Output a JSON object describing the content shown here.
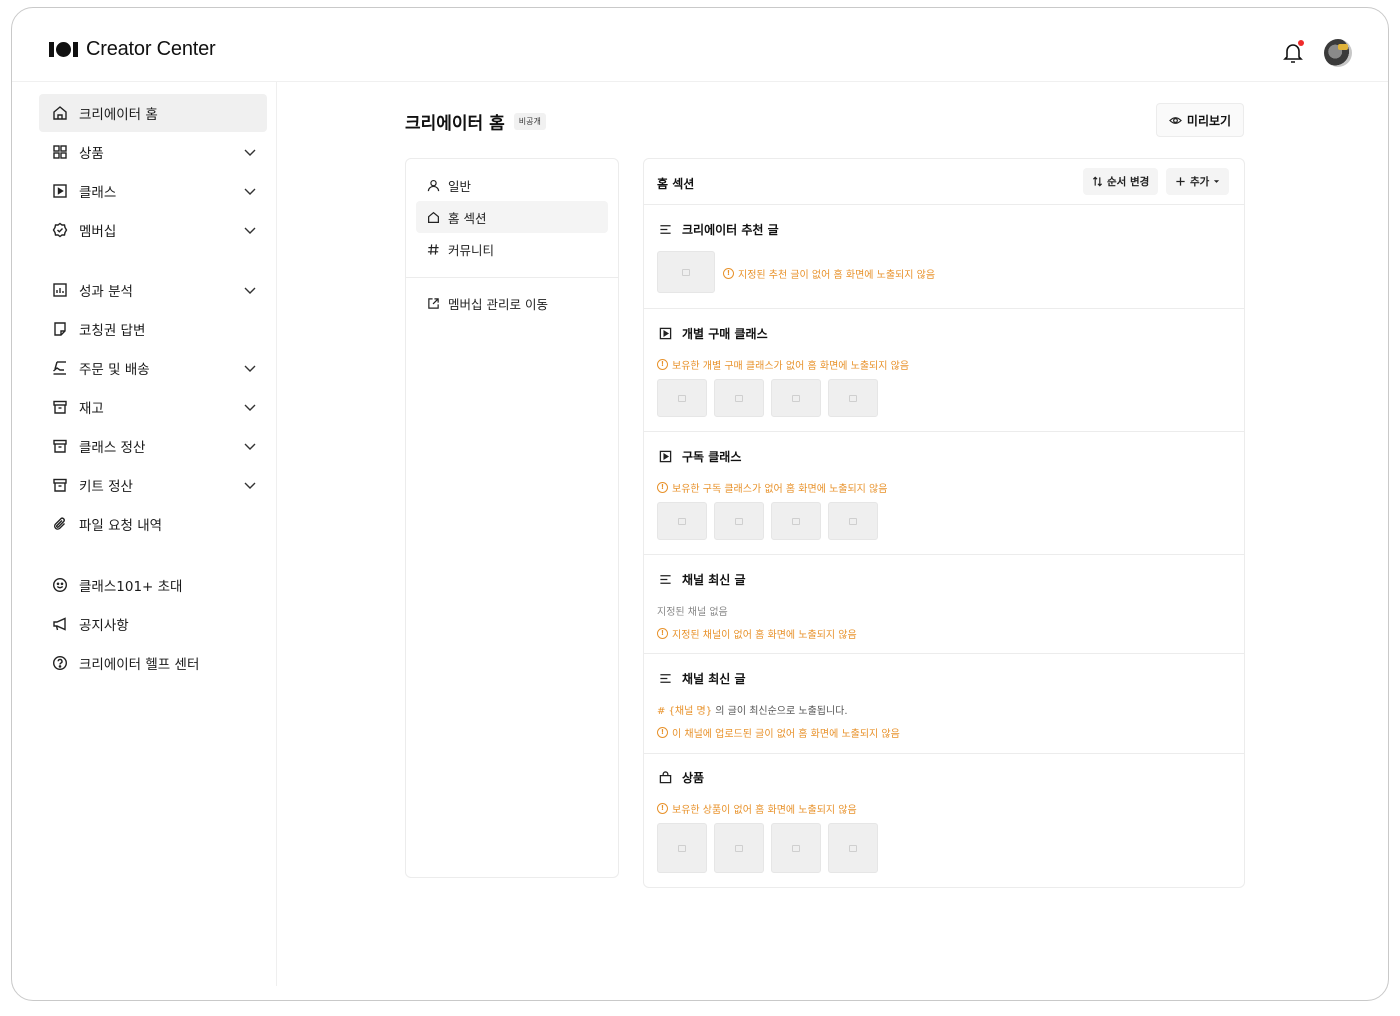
{
  "app": {
    "title": "Creator Center"
  },
  "sidebar": {
    "items": [
      {
        "label": "크리에이터 홈",
        "icon": "home-icon",
        "active": true,
        "expandable": false
      },
      {
        "label": "상품",
        "icon": "grid-icon",
        "active": false,
        "expandable": true
      },
      {
        "label": "클래스",
        "icon": "play-square-icon",
        "active": false,
        "expandable": true
      },
      {
        "label": "멤버십",
        "icon": "badge-check-icon",
        "active": false,
        "expandable": true
      },
      {
        "label": "성과 분석",
        "icon": "chart-icon",
        "active": false,
        "expandable": true
      },
      {
        "label": "코칭권 답변",
        "icon": "note-icon",
        "active": false,
        "expandable": false
      },
      {
        "label": "주문 및 배송",
        "icon": "delivery-icon",
        "active": false,
        "expandable": true
      },
      {
        "label": "재고",
        "icon": "archive-icon",
        "active": false,
        "expandable": true
      },
      {
        "label": "클래스 정산",
        "icon": "archive-icon",
        "active": false,
        "expandable": true
      },
      {
        "label": "키트 정산",
        "icon": "archive-icon",
        "active": false,
        "expandable": true
      },
      {
        "label": "파일 요청 내역",
        "icon": "paperclip-icon",
        "active": false,
        "expandable": false
      },
      {
        "label": "클래스101+ 초대",
        "icon": "smile-icon",
        "active": false,
        "expandable": false
      },
      {
        "label": "공지사항",
        "icon": "megaphone-icon",
        "active": false,
        "expandable": false
      },
      {
        "label": "크리에이터 헬프 센터",
        "icon": "help-icon",
        "active": false,
        "expandable": false
      }
    ]
  },
  "main": {
    "title": "크리에이터 홈",
    "badge": "비공개",
    "preview_label": "미리보기",
    "tabs": [
      {
        "label": "일반",
        "icon": "user-icon",
        "active": false
      },
      {
        "label": "홈 섹션",
        "icon": "home-icon",
        "active": true
      },
      {
        "label": "커뮤니티",
        "icon": "hash-icon",
        "active": false
      }
    ],
    "membership_link": "멤버십 관리로 이동",
    "sections_title": "홈 섹션",
    "reorder_label": "순서 변경",
    "add_label": "추가",
    "sections": [
      {
        "title": "크리에이터 추천 글",
        "icon": "text-lines-icon",
        "warning": "지정된 추천 글이 없어 홈 화면에 노출되지 않음"
      },
      {
        "title": "개별 구매 클래스",
        "icon": "play-square-icon",
        "warning": "보유한 개별 구매 클래스가 없어 홈 화면에 노출되지 않음"
      },
      {
        "title": "구독 클래스",
        "icon": "play-square-icon",
        "warning": "보유한 구독 클래스가 없어 홈 화면에 노출되지 않음"
      },
      {
        "title": "채널 최신 글",
        "icon": "text-lines-icon",
        "note": "지정된 채널 없음",
        "warning": "지정된 채널이 없어 홈 화면에 노출되지 않음"
      },
      {
        "title": "채널 최신 글",
        "icon": "text-lines-icon",
        "note_hash": "# {채널 명}",
        "note": "의 글이 최신순으로 노출됩니다.",
        "warning": "이 채널에 업로드된 글이 없어 홈 화면에 노출되지 않음"
      },
      {
        "title": "상품",
        "icon": "bag-icon",
        "warning": "보유한 상품이 없어 홈 화면에 노출되지 않음"
      }
    ]
  },
  "colors": {
    "warning": "#e8922b",
    "notification_dot": "#ef2b2b",
    "active_bg": "#f0f0f0"
  }
}
